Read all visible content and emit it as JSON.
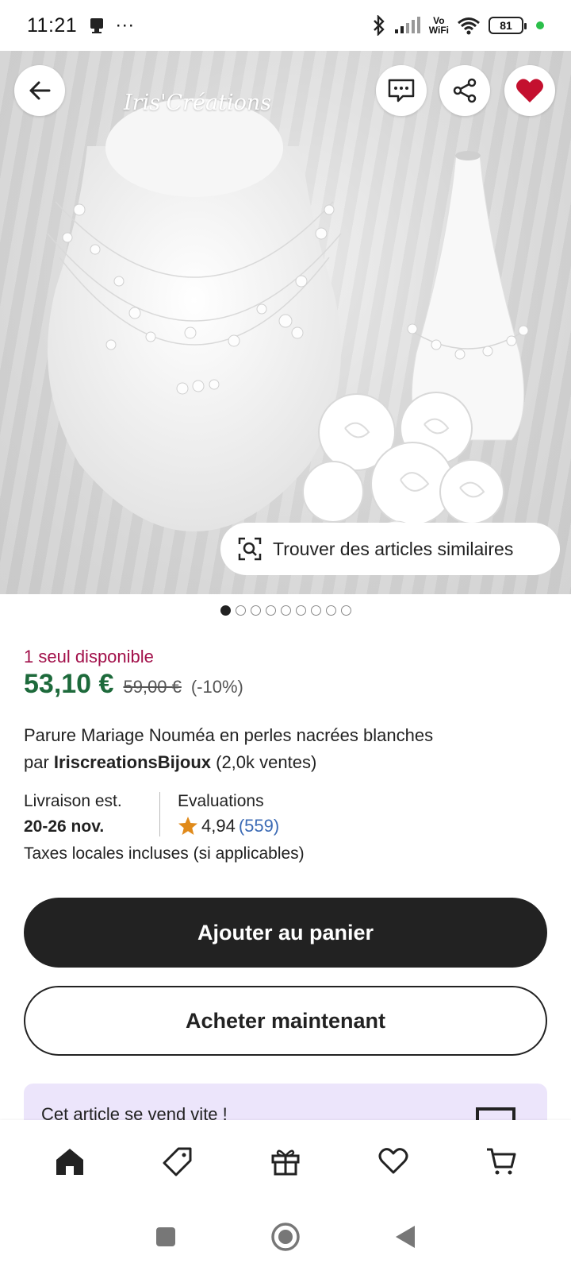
{
  "status_bar": {
    "time": "11:21",
    "extra": "···",
    "wifi_label_top": "Vo",
    "wifi_label_bottom": "WiFi",
    "battery": "81"
  },
  "hero": {
    "watermark": "Iris'Créations",
    "similar_label": "Trouver des articles similaires",
    "page_count": 9,
    "active_page": 1
  },
  "product": {
    "availability": "1 seul disponible",
    "price": "53,10 €",
    "old_price": "59,00 €",
    "discount": "(-10%)",
    "title": "Parure Mariage Nouméa en perles nacrées blanches",
    "by": "par",
    "shop": "IriscreationsBijoux",
    "sales": "(2,0k ventes)",
    "delivery_label": "Livraison est.",
    "delivery_value": "20-26 nov.",
    "reviews_label": "Evaluations",
    "rating": "4,94",
    "review_count": "(559)",
    "taxes": "Taxes locales incluses (si applicables)"
  },
  "actions": {
    "add_to_cart": "Ajouter au panier",
    "buy_now": "Acheter maintenant"
  },
  "promo": {
    "text": "Cet article se vend vite !"
  },
  "colors": {
    "price": "#1d6a3b",
    "availability": "#a2104a",
    "favorite": "#c4102f",
    "review_count": "#3c6bb5",
    "star": "#e08a1a",
    "promo_bg": "#ece5fb"
  },
  "bottom_nav": [
    "home-icon",
    "tag-icon",
    "gift-icon",
    "heart-icon",
    "cart-icon"
  ]
}
